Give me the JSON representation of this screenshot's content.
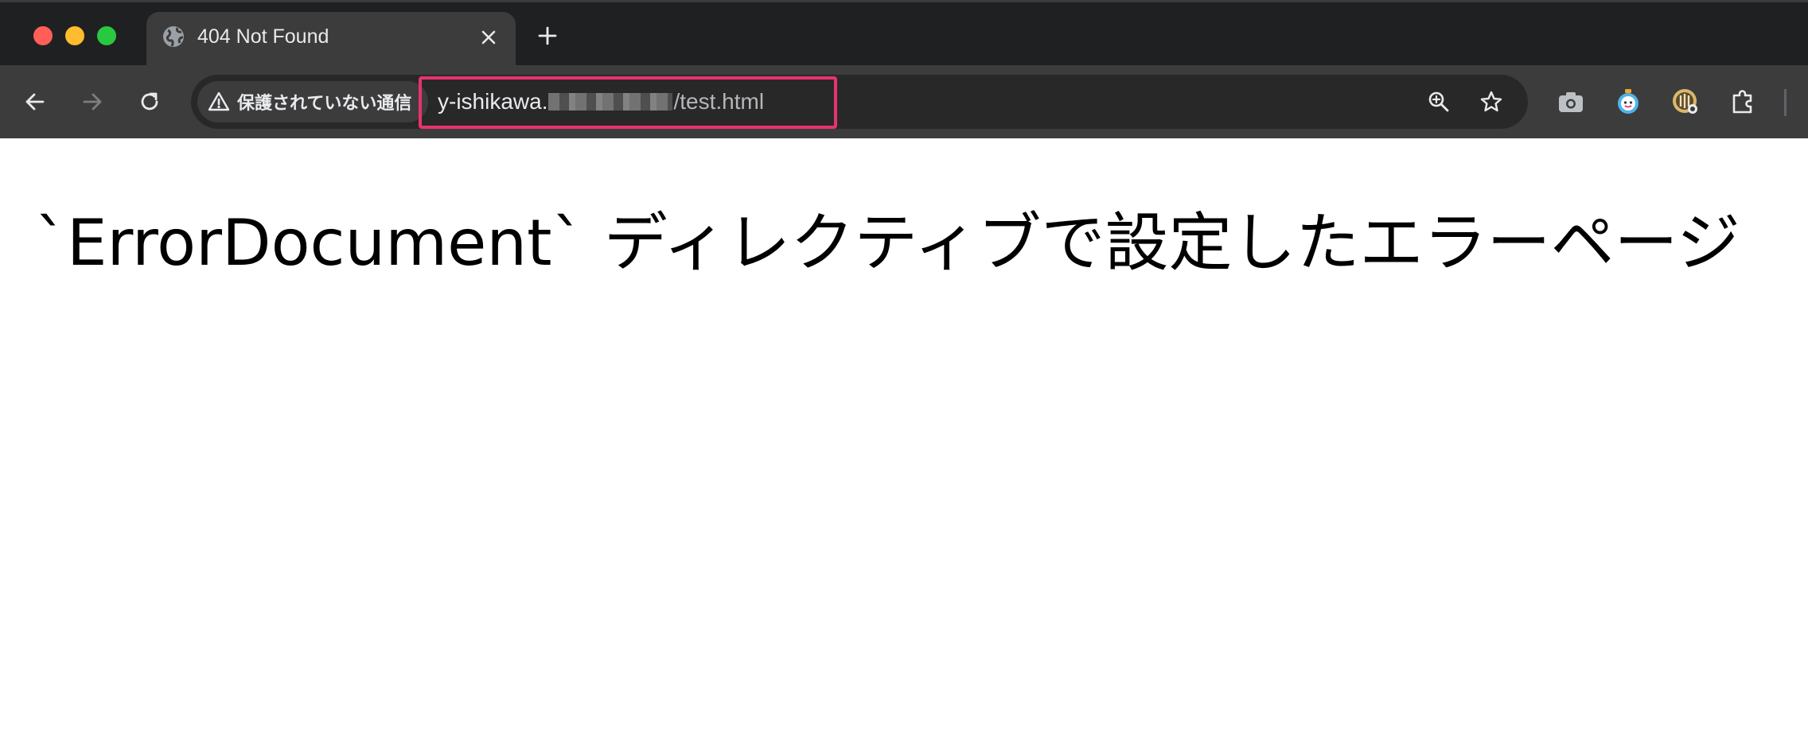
{
  "tab": {
    "title": "404 Not Found",
    "close_icon": "close-icon",
    "new_tab_icon": "plus-icon",
    "favicon": "globe-icon"
  },
  "navigation": {
    "back_icon": "arrow-left-icon",
    "forward_icon": "arrow-right-icon",
    "reload_icon": "reload-icon"
  },
  "omnibox": {
    "security_label": "保護されていない通信",
    "security_icon": "warning-icon",
    "url_prefix": "y-ishikawa.",
    "url_suffix": "/test.html",
    "highlight_color": "#e8336d"
  },
  "extensions": [
    "camera-icon",
    "timer-icon",
    "circle-extension-icon",
    "puzzle-icon"
  ],
  "page": {
    "heading": "`ErrorDocument` ディレクティブで設定したエラーページ"
  },
  "colors": {
    "tabstrip": "#1f2021",
    "toolbar": "#3c3c3c",
    "omnibox": "#282828",
    "traffic_red": "#ff5f57",
    "traffic_yellow": "#febc2e",
    "traffic_green": "#28c840"
  }
}
